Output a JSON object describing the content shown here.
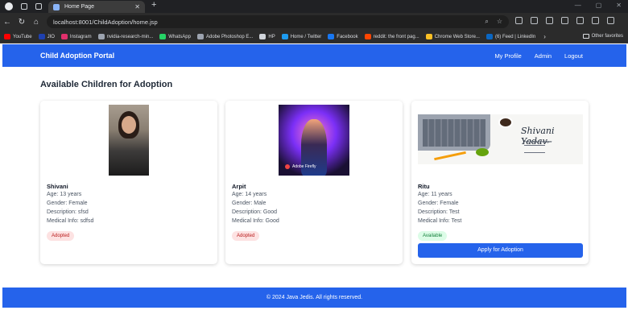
{
  "browser": {
    "tab_title": "Home Page",
    "url": "localhost:8001/ChildAdoption/home.jsp",
    "new_tab_symbol": "+",
    "tab_close_symbol": "✕"
  },
  "bookmarks": [
    {
      "label": "YouTube",
      "color": "#ff0000"
    },
    {
      "label": "JIO",
      "color": "#1e40af"
    },
    {
      "label": "Instagram",
      "color": "#e1306c"
    },
    {
      "label": "nvidia-research-min...",
      "color": "#9ca3af"
    },
    {
      "label": "WhatsApp",
      "color": "#25d366"
    },
    {
      "label": "Adobe Photoshop E...",
      "color": "#9ca3af"
    },
    {
      "label": "HP",
      "color": "#d1d5db"
    },
    {
      "label": "Home / Twitter",
      "color": "#1d9bf0"
    },
    {
      "label": "Facebook",
      "color": "#1877f2"
    },
    {
      "label": "reddit: the front pag...",
      "color": "#ff4500"
    },
    {
      "label": "Chrome Web Store...",
      "color": "#fbbf24"
    },
    {
      "label": "(6) Feed | LinkedIn",
      "color": "#0a66c2"
    }
  ],
  "bookmarks_other": "Other favorites",
  "app": {
    "brand": "Child Adoption Portal",
    "nav": [
      "My Profile",
      "Admin",
      "Logout"
    ],
    "heading": "Available Children for Adoption",
    "footer": "© 2024 Java Jedis. All rights reserved.",
    "apply_label": "Apply for Adoption",
    "children": [
      {
        "name": "Shivani",
        "age": "Age: 13 years",
        "gender": "Gender: Female",
        "description": "Description: sfsd",
        "medical": "Medical Info: sdfsd",
        "status": "Adopted"
      },
      {
        "name": "Arpit",
        "age": "Age: 14 years",
        "gender": "Gender: Male",
        "description": "Description: Good",
        "medical": "Medical Info: Good",
        "status": "Adopted",
        "image_caption": "Adobe Firefly"
      },
      {
        "name": "Ritu",
        "age": "Age: 11 years",
        "gender": "Gender: Female",
        "description": "Description: Test",
        "medical": "Medical Info: Test",
        "status": "Available",
        "image_signature": "Shivani Yadav",
        "image_subtitle": "Full Stack Developer"
      }
    ]
  },
  "colors": {
    "primary": "#2563eb",
    "adopted_bg": "#fde2e2",
    "adopted_text": "#b91c1c",
    "available_bg": "#dcfce7",
    "available_text": "#15803d"
  }
}
